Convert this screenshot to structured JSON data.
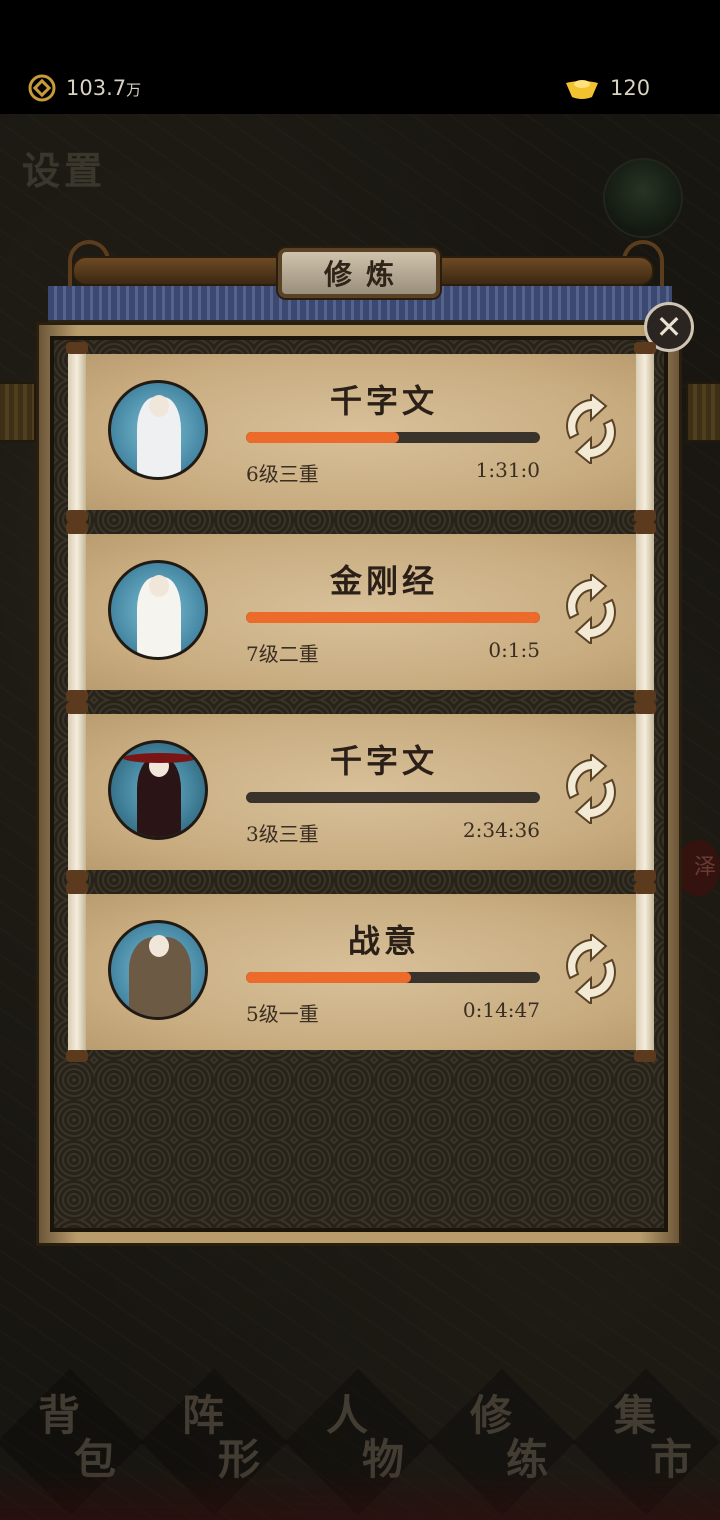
{
  "topbar": {
    "coins": {
      "value": "103.7",
      "unit": "万",
      "icon": "copper-coin-icon"
    },
    "ingots": {
      "value": "120",
      "icon": "gold-ingot-icon"
    }
  },
  "map": {
    "settings_label": "设置",
    "side_seal": "泽"
  },
  "modal": {
    "title": "修炼",
    "close_icon": "close-icon",
    "cards": [
      {
        "name": "千字文",
        "level": "6级三重",
        "timer": "1:31:0",
        "progress": 0.52
      },
      {
        "name": "金刚经",
        "level": "7级二重",
        "timer": "0:1:5",
        "progress": 1.0
      },
      {
        "name": "千字文",
        "level": "3级三重",
        "timer": "2:34:36",
        "progress": 0.0
      },
      {
        "name": "战意",
        "level": "5级一重",
        "timer": "0:14:47",
        "progress": 0.56
      }
    ]
  },
  "nav": [
    {
      "c1": "背",
      "c2": "包"
    },
    {
      "c1": "阵",
      "c2": "形"
    },
    {
      "c1": "人",
      "c2": "物"
    },
    {
      "c1": "修",
      "c2": "练"
    },
    {
      "c1": "集",
      "c2": "市"
    }
  ],
  "colors": {
    "progress": "#ec6a2a",
    "track": "#3a332b",
    "paper": "#c8ac80"
  }
}
